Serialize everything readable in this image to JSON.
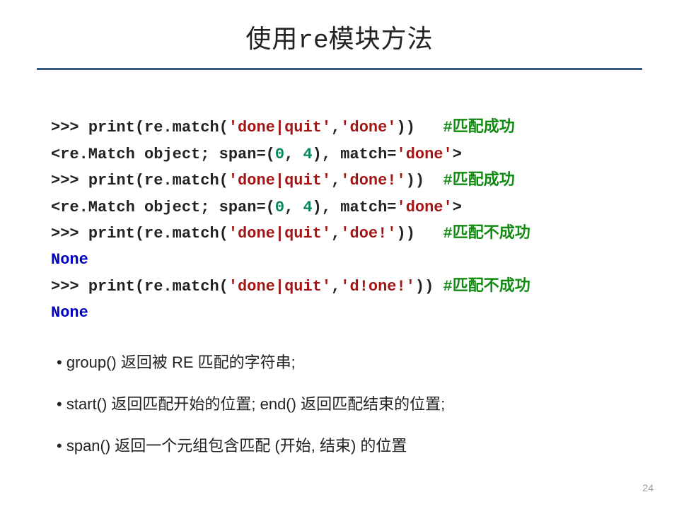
{
  "title": {
    "pre": "使用",
    "mono": "re",
    "post": "模块方法"
  },
  "code": {
    "l1": {
      "prompt": ">>> ",
      "call_pre": "print(re.match(",
      "arg1": "'done|quit'",
      "sep": ",",
      "arg2": "'done'",
      "call_post": "))   ",
      "comment": "#匹配成功"
    },
    "l2": {
      "text_pre": "<re.Match object; span=(",
      "n0": "0",
      "comma": ", ",
      "n1": "4",
      "text_mid": "), match=",
      "mstr": "'done'",
      "text_post": ">"
    },
    "l3": {
      "prompt": ">>> ",
      "call_pre": "print(re.match(",
      "arg1": "'done|quit'",
      "sep": ",",
      "arg2": "'done!'",
      "call_post": "))  ",
      "comment": "#匹配成功"
    },
    "l4": {
      "text_pre": "<re.Match object; span=(",
      "n0": "0",
      "comma": ", ",
      "n1": "4",
      "text_mid": "), match=",
      "mstr": "'done'",
      "text_post": ">"
    },
    "l5": {
      "prompt": ">>> ",
      "call_pre": "print(re.match(",
      "arg1": "'done|quit'",
      "sep": ",",
      "arg2": "'doe!'",
      "call_post": "))   ",
      "comment": "#匹配不成功"
    },
    "l6": {
      "none": "None"
    },
    "l7": {
      "prompt": ">>> ",
      "call_pre": "print(re.match(",
      "arg1": "'done|quit'",
      "sep": ",",
      "arg2": "'d!one!'",
      "call_post": ")) ",
      "comment": "#匹配不成功"
    },
    "l8": {
      "none": "None"
    }
  },
  "bullets": {
    "b1": "group()  返回被 RE 匹配的字符串;",
    "b2": "start() 返回匹配开始的位置;  end() 返回匹配结束的位置;",
    "b3": "span() 返回一个元组包含匹配 (开始, 结束) 的位置"
  },
  "page_number": "24"
}
